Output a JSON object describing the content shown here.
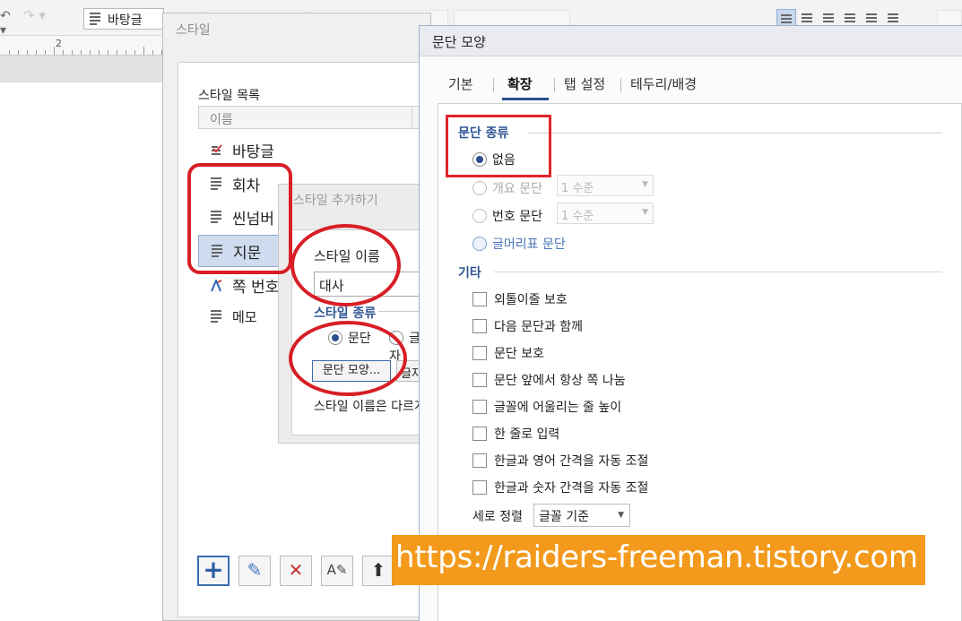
{
  "toolbar": {
    "style_combo_value": "바탕글",
    "undo_glyph": "↶ ▾",
    "redo_glyph": "↷ ▾"
  },
  "ruler": {
    "mark": "2"
  },
  "style_dialog": {
    "title": "스타일",
    "list_label": "스타일 목록",
    "column_header": "이름",
    "items": [
      {
        "label": "바탕글"
      },
      {
        "label": "회차"
      },
      {
        "label": "씬넘버"
      },
      {
        "label": "지문"
      },
      {
        "label": "쪽 번호"
      },
      {
        "label": "메모"
      }
    ],
    "buttons": {
      "add": "+",
      "edit": "✎",
      "delete": "✕",
      "edit_style": "A✎",
      "move_up": "⬆"
    }
  },
  "add_style_dialog": {
    "title": "스타일 추가하기",
    "name_label": "스타일 이름",
    "name_value": "대사",
    "kind_label": "스타일 종류",
    "kind_paragraph": "문단",
    "kind_char": "글자",
    "para_shape_button": "문단 모양...",
    "char_shape_button": "글자 모양...",
    "note": "스타일 이름은 다르게 지정하세요"
  },
  "para_dialog": {
    "title": "문단 모양",
    "tabs": [
      "기본",
      "확장",
      "탭 설정",
      "테두리/배경"
    ],
    "active_tab": "확장",
    "para_kind_title": "문단 종류",
    "para_kind_options": {
      "none": "없음",
      "outline": "개요 문단",
      "number": "번호 문단",
      "bullet": "글머리표 문단"
    },
    "level_combo": "1 수준",
    "other_title": "기타",
    "checkboxes": [
      "외톨이줄 보호",
      "다음 문단과 함께",
      "문단 보호",
      "문단 앞에서 항상 쪽 나눔",
      "글꼴에 어울리는 줄 높이",
      "한 줄로 입력",
      "한글과 영어 간격을 자동 조절",
      "한글과 숫자 간격을 자동 조절"
    ],
    "valign_label": "세로 정렬",
    "valign_value": "글꼴 기준"
  },
  "watermark": "https://raiders-freeman.tistory.com",
  "colors": {
    "annotation_red": "#d81e26",
    "banner_orange": "#f39a1c",
    "accent_blue": "#2f5694"
  }
}
